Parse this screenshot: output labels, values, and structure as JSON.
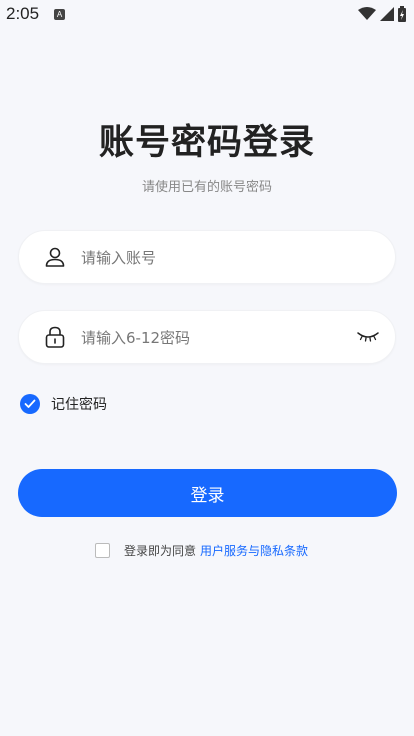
{
  "status_bar": {
    "time": "2:05",
    "app_icon_letter": "A"
  },
  "header": {
    "title": "账号密码登录",
    "subtitle": "请使用已有的账号密码"
  },
  "form": {
    "account_placeholder": "请输入账号",
    "account_value": "",
    "password_placeholder": "请输入6-12密码",
    "password_value": "",
    "remember_label": "记住密码",
    "remember_checked": true
  },
  "login_button_label": "登录",
  "agreement": {
    "text": "登录即为同意",
    "link": "用户服务与隐私条款",
    "checked": false
  },
  "colors": {
    "accent": "#1769ff",
    "background": "#f6f7fb"
  }
}
